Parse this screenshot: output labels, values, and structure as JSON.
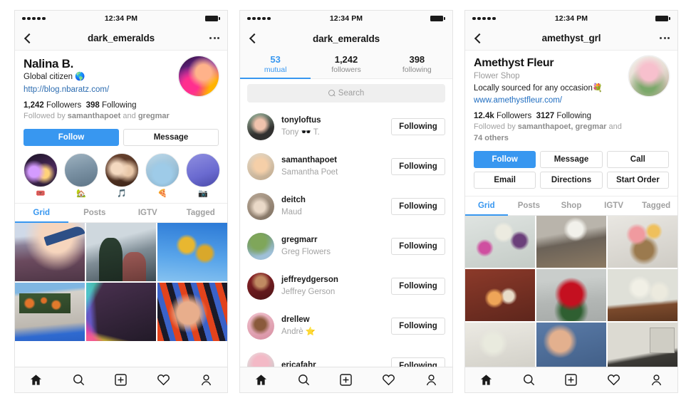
{
  "statusbar": {
    "time": "12:34 PM",
    "signal_dots": 5,
    "battery_icon": "battery-full-icon"
  },
  "accent_blue": "#3897f0",
  "link_blue": "#2c6cb0",
  "panels": [
    {
      "id": "profile-dark-emeralds",
      "nav": {
        "back_icon": "chevron-left-icon",
        "title": "dark_emeralds",
        "more_icon": "ellipsis-icon"
      },
      "profile": {
        "display_name": "Nalina B.",
        "bio": "Global citizen 🌎",
        "url": "http://blog.nbaratz.com/",
        "followers_count": "1,242",
        "followers_label": "Followers",
        "following_count": "398",
        "following_label": "Following",
        "followed_by_prefix": "Followed by ",
        "followed_by_user1": "samanthapoet",
        "followed_by_mid": " and ",
        "followed_by_user2": "gregmar",
        "avatar_icon": "profile-avatar"
      },
      "actions": [
        {
          "label": "Follow",
          "primary": true
        },
        {
          "label": "Message",
          "primary": false
        }
      ],
      "highlights": [
        {
          "emoji": "🎟️",
          "name": "highlight-ticket"
        },
        {
          "emoji": "🏡",
          "name": "highlight-park"
        },
        {
          "emoji": "🎵",
          "name": "highlight-music"
        },
        {
          "emoji": "🍕",
          "name": "highlight-pizza"
        },
        {
          "emoji": "📷",
          "name": "highlight-camera"
        }
      ],
      "tabs": [
        {
          "label": "Grid",
          "active": true
        },
        {
          "label": "Posts",
          "active": false
        },
        {
          "label": "IGTV",
          "active": false
        },
        {
          "label": "Tagged",
          "active": false
        }
      ],
      "grid": [
        {
          "name": "post-airplane-sunset"
        },
        {
          "name": "post-two-friends-drinks"
        },
        {
          "name": "post-sunflowers-sky"
        },
        {
          "name": "post-wall-oranges"
        },
        {
          "name": "post-holographic"
        },
        {
          "name": "post-portrait-stripes"
        }
      ]
    },
    {
      "id": "followers-list-dark-emeralds",
      "nav": {
        "back_icon": "chevron-left-icon",
        "title": "dark_emeralds",
        "more_icon": null
      },
      "segments": [
        {
          "count": "53",
          "label": "mutual",
          "active": true
        },
        {
          "count": "1,242",
          "label": "followers",
          "active": false
        },
        {
          "count": "398",
          "label": "following",
          "active": false
        }
      ],
      "search": {
        "placeholder": "Search",
        "value": "",
        "icon": "search-icon"
      },
      "users": [
        {
          "username": "tonyloftus",
          "fullname": "Tony 🕶️ T.",
          "button": "Following"
        },
        {
          "username": "samanthapoet",
          "fullname": "Samantha Poet",
          "button": "Following"
        },
        {
          "username": "deitch",
          "fullname": "Maud",
          "button": "Following"
        },
        {
          "username": "gregmarr",
          "fullname": "Greg Flowers",
          "button": "Following"
        },
        {
          "username": "jeffreydgerson",
          "fullname": "Jeffrey Gerson",
          "button": "Following"
        },
        {
          "username": "drellew",
          "fullname": "Andrè ⭐",
          "button": "Following"
        },
        {
          "username": "ericafahr",
          "fullname": "",
          "button": "Following"
        }
      ]
    },
    {
      "id": "profile-amethyst-grl",
      "nav": {
        "back_icon": "chevron-left-icon",
        "title": "amethyst_grl",
        "more_icon": "ellipsis-icon"
      },
      "profile": {
        "display_name": "Amethyst Fleur",
        "category": "Flower Shop",
        "bio": "Locally sourced for any occasion💐",
        "url": "www.amethystfleur.com/",
        "followers_count": "12.4k",
        "followers_label": "Followers",
        "following_count": "3127",
        "following_label": "Following",
        "followed_by_prefix": "Followed by ",
        "followed_by_user1": "samanthapoet, gregmar",
        "followed_by_mid": " and ",
        "followed_by_user2": "74 others",
        "avatar_icon": "profile-avatar"
      },
      "actions_row1": [
        {
          "label": "Follow",
          "primary": true
        },
        {
          "label": "Message",
          "primary": false
        },
        {
          "label": "Call",
          "primary": false
        }
      ],
      "actions_row2": [
        {
          "label": "Email",
          "primary": false
        },
        {
          "label": "Directions",
          "primary": false
        },
        {
          "label": "Start Order",
          "primary": false
        }
      ],
      "tabs": [
        {
          "label": "Grid",
          "active": true
        },
        {
          "label": "Posts",
          "active": false
        },
        {
          "label": "Shop",
          "active": false
        },
        {
          "label": "IGTV",
          "active": false
        },
        {
          "label": "Tagged",
          "active": false
        }
      ],
      "grid": [
        {
          "name": "post-flower-crowns"
        },
        {
          "name": "post-living-room-vase"
        },
        {
          "name": "post-basket-bouquet"
        },
        {
          "name": "post-rose-arrangement"
        },
        {
          "name": "post-red-roses"
        },
        {
          "name": "post-daisies-shelf"
        },
        {
          "name": "post-white-blooms"
        },
        {
          "name": "post-denim-hands"
        },
        {
          "name": "post-shop-window"
        }
      ]
    }
  ],
  "tabbar": [
    {
      "name": "home-icon",
      "label": "Home"
    },
    {
      "name": "search-icon",
      "label": "Search"
    },
    {
      "name": "add-post-icon",
      "label": "Add"
    },
    {
      "name": "heart-icon",
      "label": "Activity"
    },
    {
      "name": "profile-icon",
      "label": "Profile"
    }
  ]
}
